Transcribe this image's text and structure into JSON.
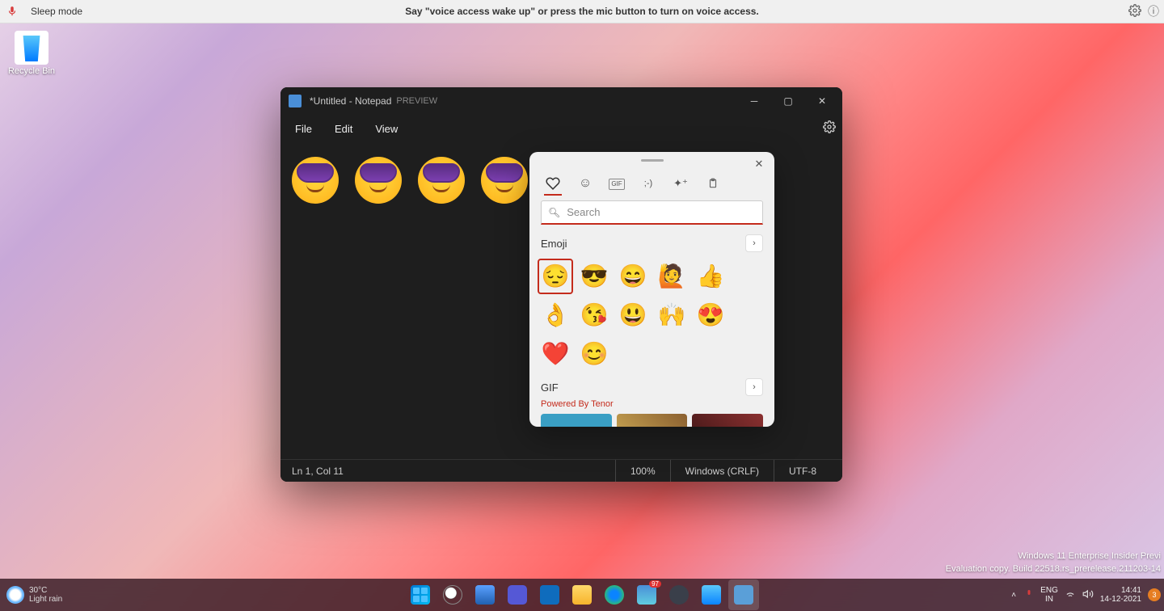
{
  "voice_bar": {
    "status": "Sleep mode",
    "message": "Say \"voice access wake up\" or press the mic button to turn on voice access."
  },
  "desktop": {
    "recycle_bin_label": "Recycle Bin"
  },
  "notepad": {
    "title": "*Untitled - Notepad",
    "title_suffix": "PREVIEW",
    "menu": {
      "file": "File",
      "edit": "Edit",
      "view": "View"
    },
    "content_emoji_count": 4,
    "status": {
      "position": "Ln 1, Col 11",
      "zoom": "100%",
      "line_ending": "Windows (CRLF)",
      "encoding": "UTF-8"
    }
  },
  "emoji_panel": {
    "search_placeholder": "Search",
    "tabs": [
      "recent",
      "emoji",
      "gif",
      "kaomoji",
      "symbols",
      "clipboard"
    ],
    "sections": {
      "emoji_header": "Emoji",
      "gif_header": "GIF",
      "gif_provider": "Powered By Tenor"
    },
    "emoji_grid": [
      "😔",
      "😎",
      "😄",
      "🙋",
      "👍",
      "👌",
      "😘",
      "😃",
      "🙌",
      "😍",
      "❤️",
      "😊"
    ]
  },
  "watermark": {
    "line1": "Windows 11 Enterprise Insider Previ",
    "line2": "Evaluation copy. Build 22518.rs_prerelease.211203-14"
  },
  "taskbar": {
    "weather": {
      "temp": "30°C",
      "desc": "Light rain"
    },
    "apps": [
      "start",
      "search",
      "taskview",
      "chat",
      "mail",
      "files",
      "edge",
      "store",
      "settings",
      "voiceapp",
      "notepad"
    ],
    "active_app": "notepad",
    "store_badge": "97",
    "tray": {
      "lang1": "ENG",
      "lang2": "IN",
      "time": "14:41",
      "date": "14-12-2021",
      "notif_count": "3"
    }
  }
}
